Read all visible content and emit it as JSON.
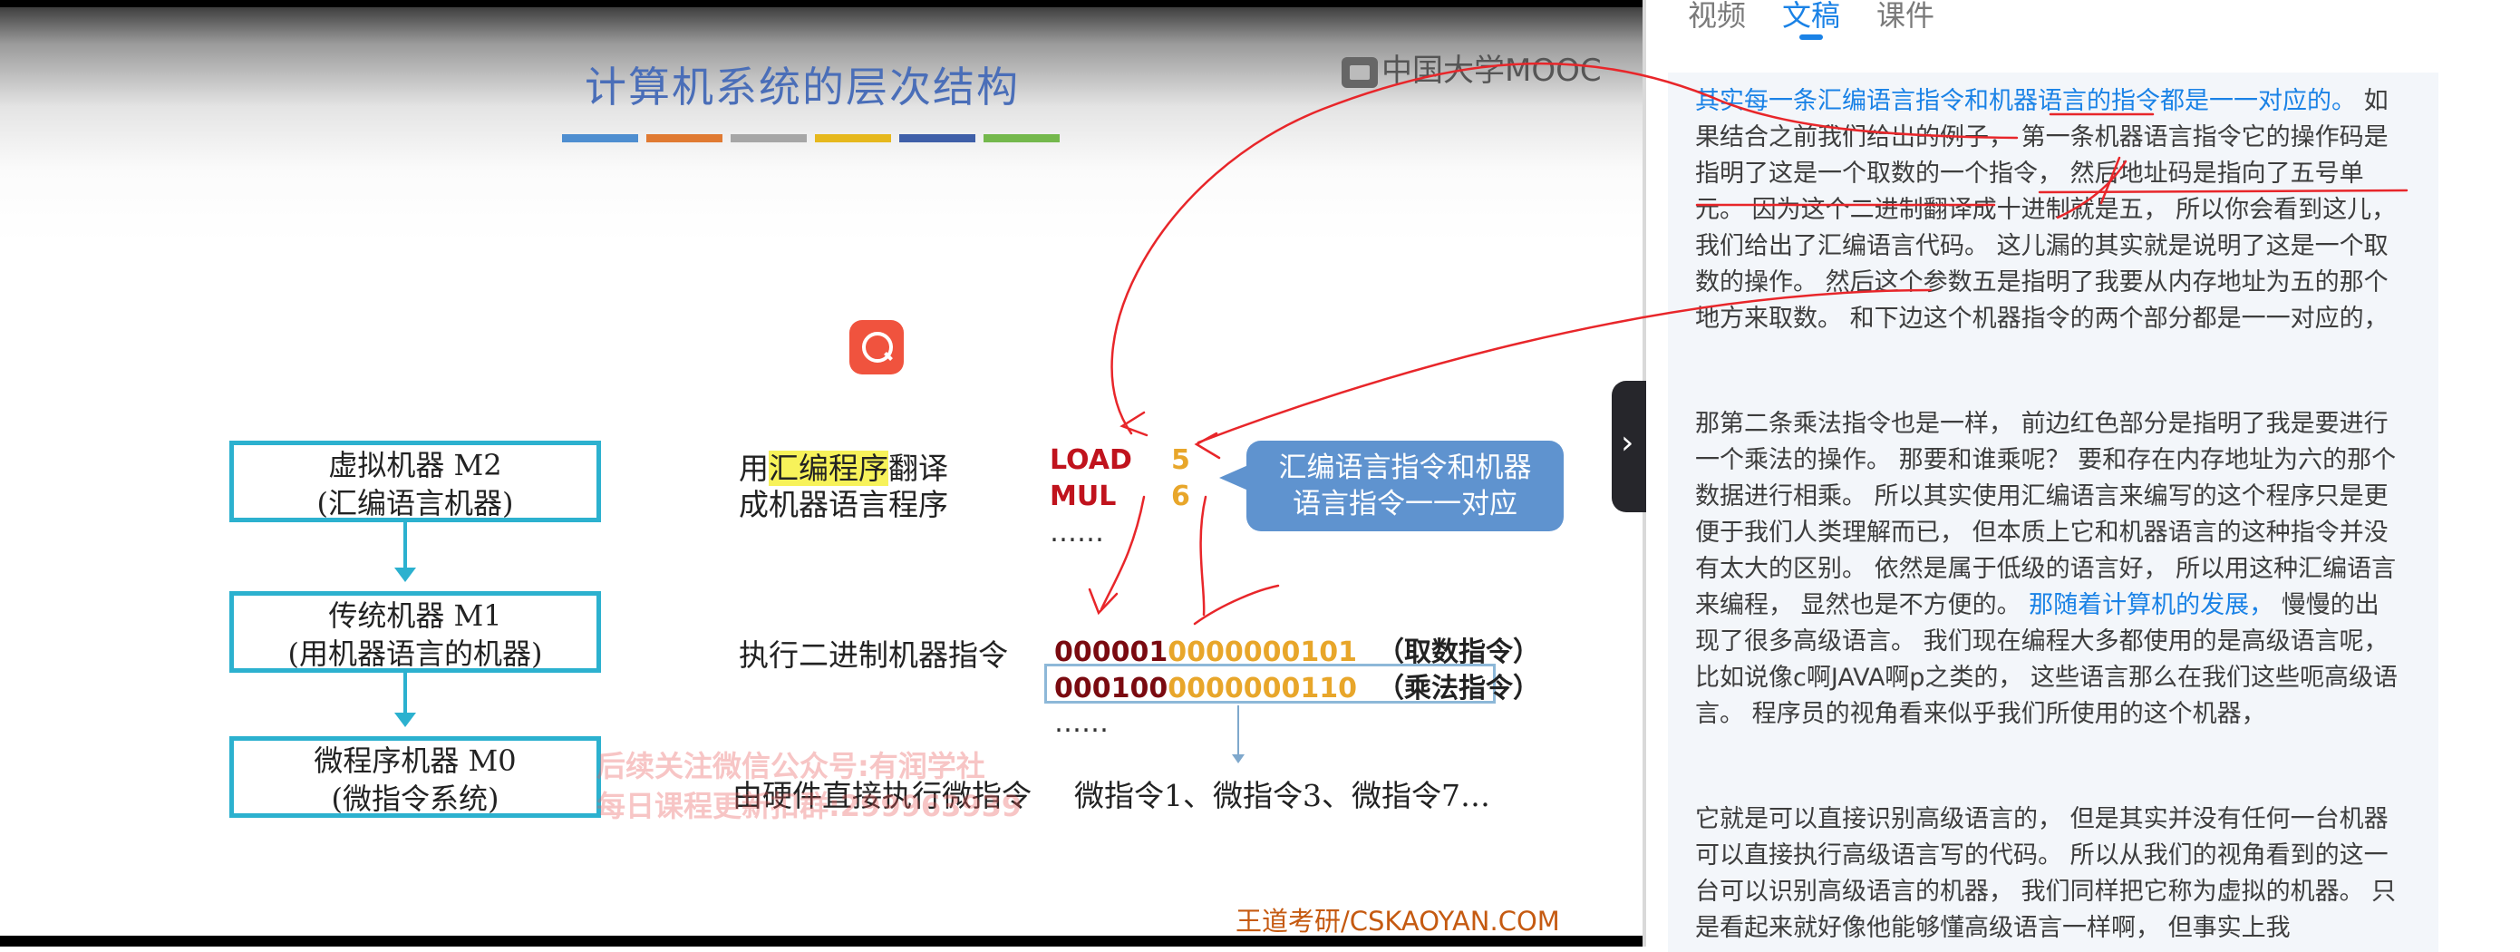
{
  "panel": {
    "tabs": [
      {
        "label": "视频"
      },
      {
        "label": "文稿"
      },
      {
        "label": "课件"
      }
    ],
    "active_tab": "文稿"
  },
  "slide": {
    "title": "计算机系统的层次结构",
    "logo_text": "中国大学MOOC",
    "color_bar": [
      "#4e8ed0",
      "#e07a32",
      "#a6a6a6",
      "#e6b81d",
      "#3f5fa8",
      "#74b84c"
    ],
    "machines": [
      {
        "line1": "虚拟机器 M2",
        "line2": "(汇编语言机器)"
      },
      {
        "line1": "传统机器 M1",
        "line2": "(用机器语言的机器)"
      },
      {
        "line1": "微程序机器 M0",
        "line2": "(微指令系统)"
      }
    ],
    "translate_label": {
      "prefix": "用",
      "highlight": "汇编程序",
      "suffix": "翻译",
      "line2": "成机器语言程序"
    },
    "asm": [
      {
        "op": "LOAD",
        "arg": "5"
      },
      {
        "op": "MUL",
        "arg": "6"
      }
    ],
    "asm_more": "……",
    "callout": {
      "line1": "汇编语言指令和机器",
      "line2": "语言指令一一对应"
    },
    "exec_label": "执行二进制机器指令",
    "machine_code": [
      {
        "opcode": "000001",
        "address": "0000000101",
        "desc": "（取数指令）"
      },
      {
        "opcode": "000100",
        "address": "0000000110",
        "desc": "（乘法指令）"
      }
    ],
    "code_more": "……",
    "micro_label": "由硬件直接执行微指令",
    "micro_list": "微指令1、微指令3、微指令7…",
    "watermark": [
      "后续关注微信公众号:有润学社",
      "每日课程更新扣群:299963939"
    ],
    "credit": "王道考研/CSKAOYAN.COM"
  },
  "transcript": {
    "p1": {
      "highlight": "其实每一条汇编语言指令和机器语言的指令都是一一对应的。",
      "rest": " 如果结合之前我们给出的例子， 第一条机器语言指令它的操作码是指明了这是一个取数的一个指令， 然后地址码是指向了五号单元。 因为这个二进制翻译成十进制就是五， 所以你会看到这儿， 我们给出了汇编语言代码。 这儿漏的其实就是说明了这是一个取数的操作。 然后这个参数五是指明了我要从内存地址为五的那个地方来取数。 和下边这个机器指令的两个部分都是一一对应的，"
    },
    "p2": {
      "pre": "那第二条乘法指令也是一样， 前边红色部分是指明了我是要进行一个乘法的操作。 那要和谁乘呢？ 要和存在内存地址为六的那个数据进行相乘。 所以其实使用汇编语言来编写的这个程序只是更便于我们人类理解而已， 但本质上它和机器语言的这种指令并没有太大的区别。 依然是属于低级的语言好， 所以用这种汇编语言来编程， 显然也是不方便的。 ",
      "highlight": "那随着计算机的发展，",
      "post": " 慢慢的出现了很多高级语言。 我们现在编程大多都使用的是高级语言呢， 比如说像c啊JAVA啊p之类的， 这些语言那么在我们这些呃高级语言。 程序员的视角看来似乎我们所使用的这个机器，"
    },
    "p3": "它就是可以直接识别高级语言的， 但是其实并没有任何一台机器可以直接执行高级语言写的代码。 所以从我们的视角看到的这一台可以识别高级语言的机器， 我们同样把它称为虚拟的机器。 只是看起来就好像他能够懂高级语言一样啊， 但事实上我"
  }
}
